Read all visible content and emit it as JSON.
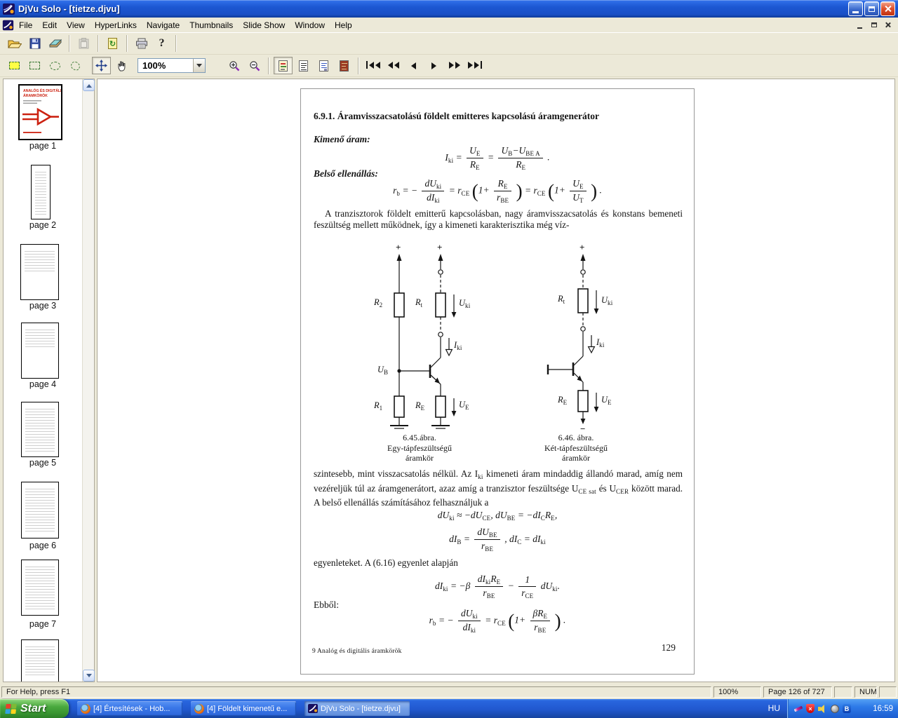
{
  "window": {
    "title": "DjVu Solo - [tietze.djvu]"
  },
  "menu": {
    "items": [
      "File",
      "Edit",
      "View",
      "HyperLinks",
      "Navigate",
      "Thumbnails",
      "Slide Show",
      "Window",
      "Help"
    ]
  },
  "toolbar": {
    "zoom_value": "100%",
    "toolbar1_icons": [
      "open",
      "save",
      "scan",
      "paste",
      "refresh-page",
      "print",
      "help"
    ],
    "toolbar2_icons": [
      "select-rect-filled",
      "select-rect",
      "select-ellipse",
      "select-polygon",
      "pan",
      "hand",
      "zoom-combo",
      "zoom-in",
      "zoom-out",
      "mode-color",
      "mode-bw",
      "mode-foreground",
      "mode-background",
      "first-page",
      "prev-fast",
      "prev-page",
      "next-page",
      "next-fast",
      "last-page"
    ]
  },
  "sidebar": {
    "cover_line1": "ANALÓG ÉS DIGITÁLIS",
    "cover_line2": "ÁRAMKÖRÖK",
    "page_labels": [
      "page 1",
      "page 2",
      "page 3",
      "page 4",
      "page 5",
      "page 6",
      "page 7"
    ]
  },
  "doc": {
    "heading": "6.9.1. Áramvisszacsatolású földelt emitteres kapcsolású áramgenerátor",
    "kimeno_label": "Kimenő áram:",
    "f1": {
      "lhs": "I_{ki} =",
      "n1": "U_{E}",
      "d1": "R_{E}",
      "eq": "=",
      "n2": "U_{B}−U_{BE A}",
      "d2": "R_{E}",
      "end": "."
    },
    "belso_label": "Belső ellenállás:",
    "f2": {
      "lhs": "r_{b} = −",
      "n1": "dU_{ki}",
      "d1": "dI_{ki}",
      "eq1": "= r_{CE}",
      "open": "(",
      "pre1": "1+",
      "n2": "R_{E}",
      "d2": "r_{BE}",
      "close": ")",
      "eq2": "= r_{CE}",
      "pre2": "1+",
      "n3": "U_{E}",
      "d3": "U_{T}",
      "end": "."
    },
    "p1": "A tranzisztorok földelt emitterű kapcsolásban, nagy áramvisszacsatolás és konstans bemeneti feszültség mellett működnek, így a kimeneti karakterisztika még víz-",
    "fig": {
      "labels": {
        "plus": "+",
        "minus": "−",
        "r2": "R_{2}",
        "r1": "R_{1}",
        "rt": "R_{t}",
        "re": "R_{E}",
        "ub": "U_{B}",
        "uki": "U_{ki}",
        "iki": "I_{ki}",
        "ue": "U_{E}"
      },
      "cap1": [
        "6.45.ábra.",
        "Egy-tápfeszültségű",
        "áramkör"
      ],
      "cap2": [
        "6.46. ábra.",
        "Két-tápfeszültségű",
        "áramkör"
      ]
    },
    "p2": "szintesebb, mint visszacsatolás nélkül. Az I_{ki} kimeneti áram mindaddig állandó marad, amíg nem vezéreljük túl az áramgenerátort, azaz amíg a tranzisztor feszültsége U_{CE sat} és U_{CER} között marad. A belső ellenállás számításához felhasználjuk a",
    "f3": "dU_{ki} ≈ −dU_{CE},   dU_{BE} = −dI_{C}R_{E},",
    "f4": {
      "lhs": "dI_{B} =",
      "n1": "dU_{BE}",
      "d1": "r_{BE}",
      "rest": ",   dI_{C} = dI_{ki}"
    },
    "p3": "egyenleteket. A (6.16) egyenlet alapján",
    "f5": {
      "lhs": "dI_{ki} = −β",
      "n1": "dI_{ki}R_{E}",
      "d1": "r_{BE}",
      "mid": "−",
      "n2": "1",
      "d2": "r_{CE}",
      "rest": "dU_{ki}."
    },
    "ebbol_label": "Ebből:",
    "f6": {
      "lhs": "r_{b} = −",
      "n1": "dU_{ki}",
      "d1": "dI_{ki}",
      "eq": "= r_{CE}",
      "open": "(",
      "pre": "1+",
      "n2": "βR_{E}",
      "d2": "r_{BE}",
      "close": ")",
      "end": "."
    },
    "footer_left": "9  Analóg és digitális áramkörök",
    "page_number": "129"
  },
  "statusbar": {
    "help": "For Help, press F1",
    "zoom": "100%",
    "page_indicator": "Page 126 of 727",
    "num": "NUM"
  },
  "taskbar": {
    "start": "Start",
    "tasks": [
      "[4] Értesítések - Hob...",
      "[4] Földelt kimenetű e...",
      "DjVu Solo - [tietze.djvu]"
    ],
    "tray": {
      "lang": "HU",
      "icons": [
        "pen-icon",
        "security-shield-icon",
        "volume-icon",
        "dialup-icon",
        "bluetooth-icon"
      ],
      "time": "16:59"
    }
  }
}
